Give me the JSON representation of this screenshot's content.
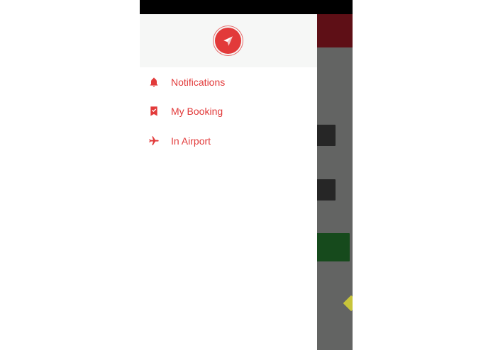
{
  "colors": {
    "accent": "#e23a3a",
    "drawer_header_bg": "#f6f7f6",
    "app_bar": "#5e0f16",
    "scrim": "#636463",
    "status_bar": "#000000"
  },
  "drawer": {
    "logo_icon": "paper-plane-icon",
    "items": [
      {
        "label": "Notifications",
        "icon": "bell-icon"
      },
      {
        "label": "My Booking",
        "icon": "bookmark-check-icon"
      },
      {
        "label": "In Airport",
        "icon": "airplane-icon"
      }
    ]
  }
}
